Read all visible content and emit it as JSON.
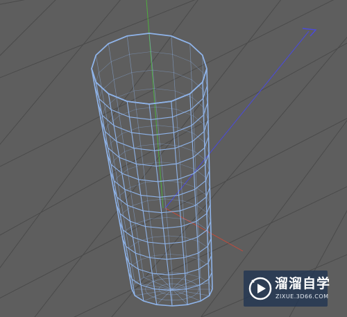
{
  "colors": {
    "background": "#5e5e5e",
    "grid_line": "#4a4a4a",
    "axis_x": "#c84a3a",
    "axis_y": "#4fae3e",
    "axis_z": "#4a4adc",
    "wireframe": "#8fb4ea",
    "watermark_bg": "#223652"
  },
  "scene": {
    "object_type": "cylinder",
    "display": "wireframe",
    "icons": [
      "z-axis-arrow-icon"
    ]
  },
  "watermark": {
    "title": "溜溜自学",
    "url": "ZIXUE.3D66.COM",
    "icon": "play-logo-icon"
  }
}
